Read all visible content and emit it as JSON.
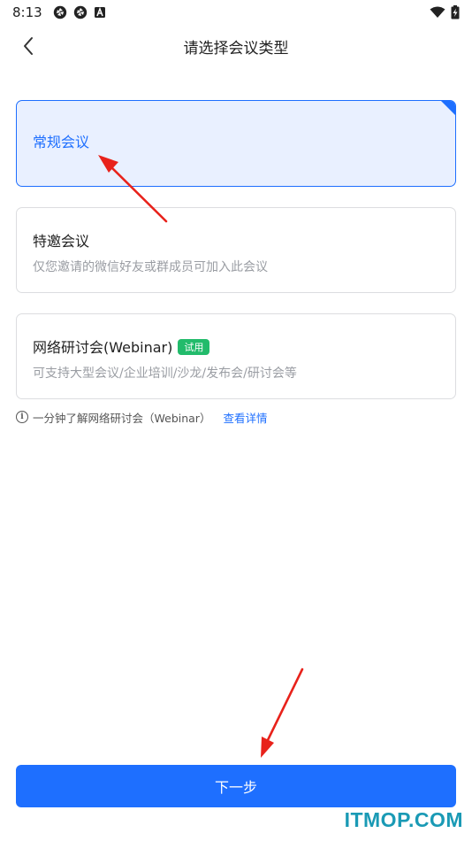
{
  "status_bar": {
    "time": "8:13",
    "left_icons": [
      "aperture-icon",
      "aperture-icon",
      "a-box-icon"
    ],
    "right_icons": [
      "wifi-icon",
      "battery-charging-icon"
    ]
  },
  "header": {
    "back_icon": "chevron-left-icon",
    "title": "请选择会议类型"
  },
  "meeting_types": [
    {
      "title": "常规会议",
      "description": "",
      "selected": true
    },
    {
      "title": "特邀会议",
      "description": "仅您邀请的微信好友或群成员可加入此会议",
      "selected": false
    },
    {
      "title": "网络研讨会(Webinar)",
      "badge": "试用",
      "description": "可支持大型会议/企业培训/沙龙/发布会/研讨会等",
      "selected": false
    }
  ],
  "info": {
    "icon": "info-icon",
    "text": "一分钟了解网络研讨会（Webinar）",
    "link_label": "查看详情"
  },
  "next_button": {
    "label": "下一步"
  },
  "watermark": "ITMOP.COM",
  "colors": {
    "accent": "#1e6fff",
    "selected_bg": "#e9f0ff",
    "badge_green": "#22bb6b",
    "annotation_red": "#e8221b",
    "watermark": "#1a9ab5"
  }
}
